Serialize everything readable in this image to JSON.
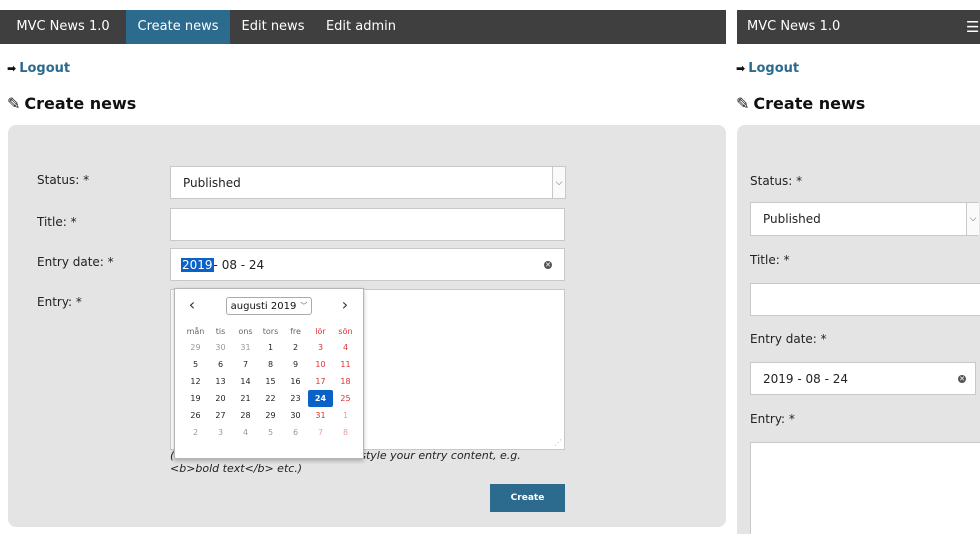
{
  "navbar": {
    "brand": "MVC News 1.0",
    "items": [
      {
        "label": "Create news",
        "active": true
      },
      {
        "label": "Edit news",
        "active": false
      },
      {
        "label": "Edit admin",
        "active": false
      }
    ]
  },
  "logout_label": "Logout",
  "page_title": "Create news",
  "form": {
    "status_label": "Status: *",
    "status_value": "Published",
    "title_label": "Title: *",
    "title_value": "",
    "entry_date_label": "Entry date: *",
    "entry_date_year": "2019",
    "entry_date_rest": " - 08 - 24",
    "entry_date_value": "2019 - 08 - 24",
    "entry_label": "Entry: *",
    "entry_value": "",
    "hint_line1": "(HTML and CSS code is allowed to style your entry content, e.g.",
    "hint_line2": "<b>bold text</b> etc.)",
    "create_label": "Create"
  },
  "datepicker": {
    "month_label": "augusti 2019",
    "weekdays": [
      "mån",
      "tis",
      "ons",
      "tors",
      "fre",
      "lör",
      "sön"
    ],
    "weeks": [
      [
        {
          "d": "29",
          "o": 1
        },
        {
          "d": "30",
          "o": 1
        },
        {
          "d": "31",
          "o": 1
        },
        {
          "d": "1"
        },
        {
          "d": "2"
        },
        {
          "d": "3"
        },
        {
          "d": "4"
        }
      ],
      [
        {
          "d": "5"
        },
        {
          "d": "6"
        },
        {
          "d": "7"
        },
        {
          "d": "8"
        },
        {
          "d": "9"
        },
        {
          "d": "10"
        },
        {
          "d": "11"
        }
      ],
      [
        {
          "d": "12"
        },
        {
          "d": "13"
        },
        {
          "d": "14"
        },
        {
          "d": "15"
        },
        {
          "d": "16"
        },
        {
          "d": "17"
        },
        {
          "d": "18"
        }
      ],
      [
        {
          "d": "19"
        },
        {
          "d": "20"
        },
        {
          "d": "21"
        },
        {
          "d": "22"
        },
        {
          "d": "23"
        },
        {
          "d": "24",
          "s": 1
        },
        {
          "d": "25"
        }
      ],
      [
        {
          "d": "26"
        },
        {
          "d": "27"
        },
        {
          "d": "28"
        },
        {
          "d": "29"
        },
        {
          "d": "30"
        },
        {
          "d": "31"
        },
        {
          "d": "1",
          "o": 1
        }
      ],
      [
        {
          "d": "2",
          "o": 1
        },
        {
          "d": "3",
          "o": 1
        },
        {
          "d": "4",
          "o": 1
        },
        {
          "d": "5",
          "o": 1
        },
        {
          "d": "6",
          "o": 1
        },
        {
          "d": "7",
          "o": 1
        },
        {
          "d": "8",
          "o": 1
        }
      ]
    ]
  },
  "colors": {
    "navbar_bg": "#3f3f3f",
    "accent": "#2c6b8d",
    "selected_date": "#0a62c9",
    "weekend_text": "#dd3333"
  },
  "icons": {
    "logout": "sign-out-icon",
    "title": "edit-icon",
    "hamburger": "hamburger-menu-icon"
  }
}
